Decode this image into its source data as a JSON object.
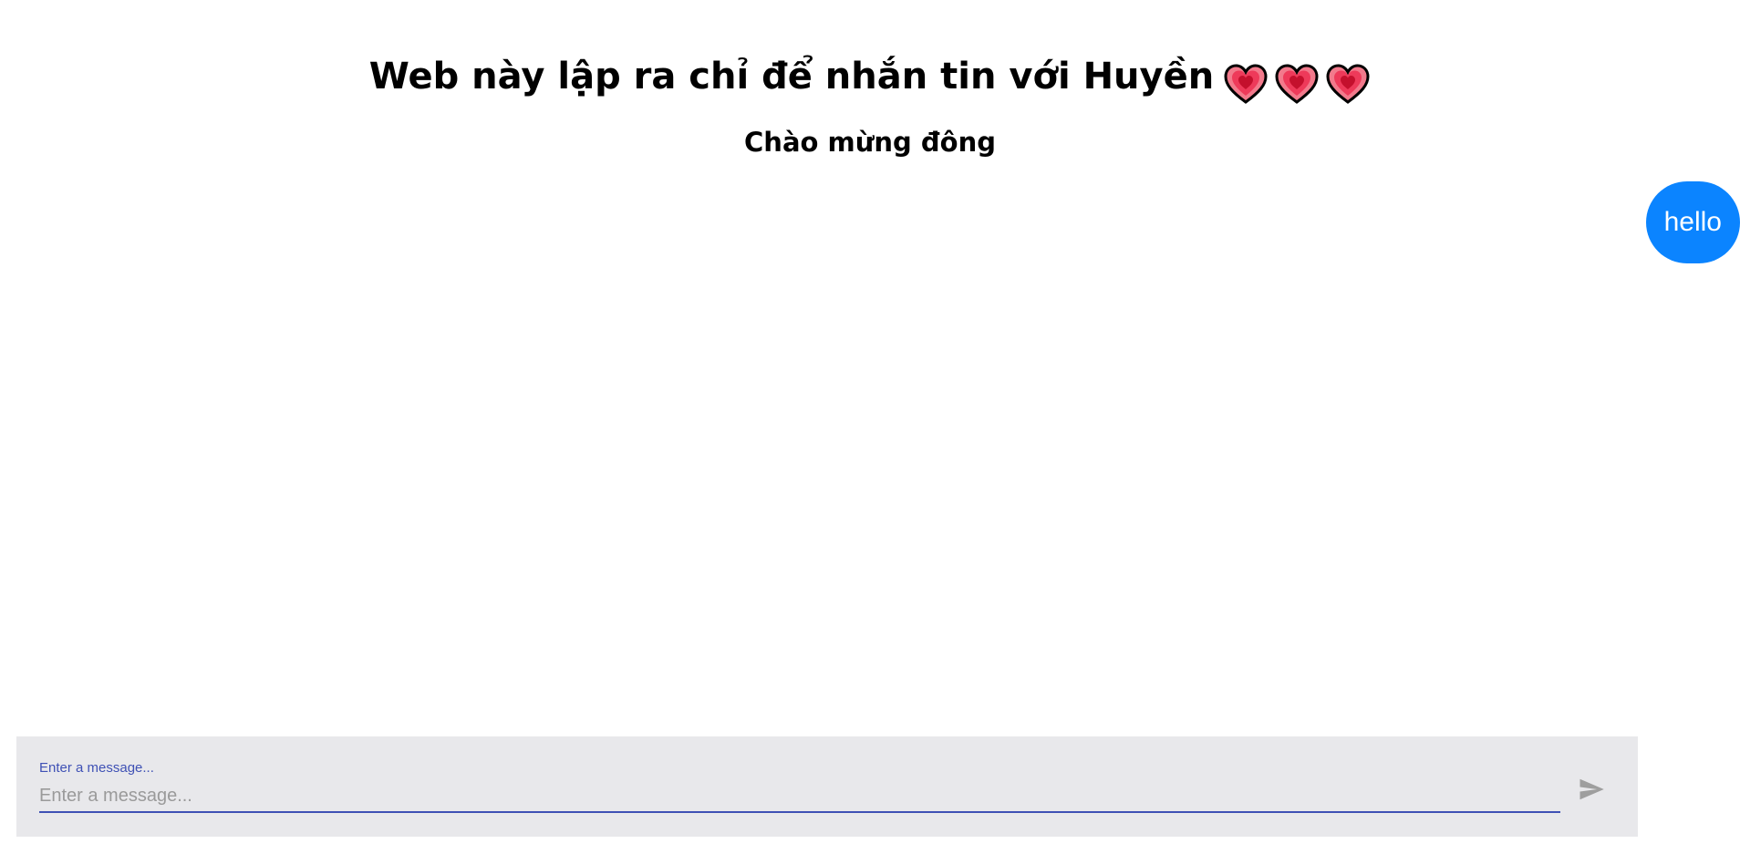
{
  "header": {
    "title": "Web này lập ra chỉ để nhắn tin với Huyền",
    "title_icons": [
      "heart-icon",
      "heart-icon",
      "heart-icon"
    ],
    "subtitle": "Chào mừng đông"
  },
  "messages": [
    {
      "text": "hello",
      "side": "right"
    }
  ],
  "composer": {
    "label": "Enter a message...",
    "placeholder": "Enter a message...",
    "value": "",
    "send_icon": "send-icon"
  },
  "colors": {
    "bubble": "#0b84ff",
    "composer_bg": "#e8e8eb",
    "input_accent": "#3f51b5",
    "send_icon": "#9e9e9e",
    "heart": "#ee3a5a"
  }
}
